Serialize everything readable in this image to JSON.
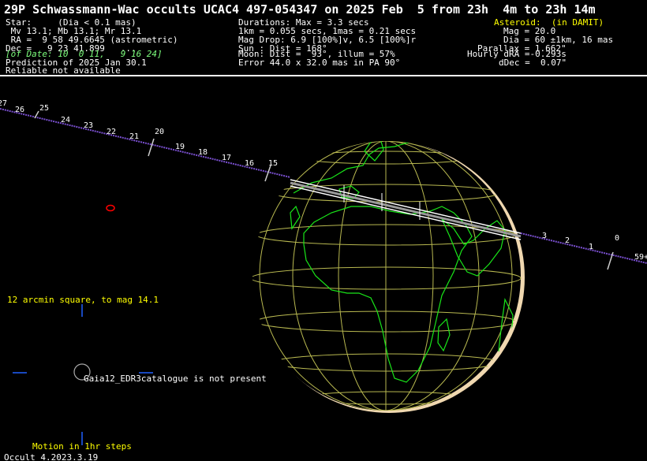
{
  "header": {
    "title": "29P Schwassmann-Wac occults UCAC4 497-054347 on 2025 Feb  5 from 23h  4m to 23h 14m",
    "left": [
      "Star:     (Dia < 0.1 mas)",
      " Mv 13.1; Mb 13.1; Mr 13.1",
      " RA =  9 58 49.6645 (astrometric)",
      "Dec =   9 23 41.899   ...",
      "Prediction of 2025 Jan 30.1",
      "Reliable not available"
    ],
    "of_date": "[of Date: 10  0 11,   9 16 24]",
    "middle": [
      "Durations: Max = 3.3 secs",
      "1km = 0.055 secs, 1mas = 0.21 secs",
      "Mag Drop: 6.9 [100%]v, 6.5 [100%]r",
      "Sun : Dist = 168°",
      "Moon: Dist =  93°, illum = 57%",
      "Error 44.0 x 32.0 mas in PA 90°"
    ],
    "asteroid_heading": "Asteroid:  (in DAMIT)",
    "right": [
      "Mag = 20.0",
      "Dia = 60 ±1km, 16 mas",
      "Parallax = 1.662\"",
      "Hourly dRA =-0.293s",
      "dDec =  0.07\""
    ]
  },
  "path_labels": [
    "27",
    "26",
    "25",
    "24",
    "23",
    "22",
    "21",
    "20",
    "19",
    "18",
    "17",
    "16",
    "15",
    "3",
    "2",
    "1",
    "0",
    "59+"
  ],
  "notes": {
    "starchart": "12 arcmin square, to mag 14.1",
    "catalogue": "Gaia12_EDR3catalogue is not present",
    "motion": "Motion in 1hr steps",
    "version": "Occult 4.2023.3.19"
  },
  "colors": {
    "background": "#000000",
    "title": "#ffffff",
    "header_yellow": "#ffff00",
    "of_date": "#7dff7d",
    "path_line": "#7a50d0",
    "grid": "#b8b850",
    "coast": "#19e619",
    "shadow": "#ffffff",
    "ellipse": "#ff0000"
  }
}
